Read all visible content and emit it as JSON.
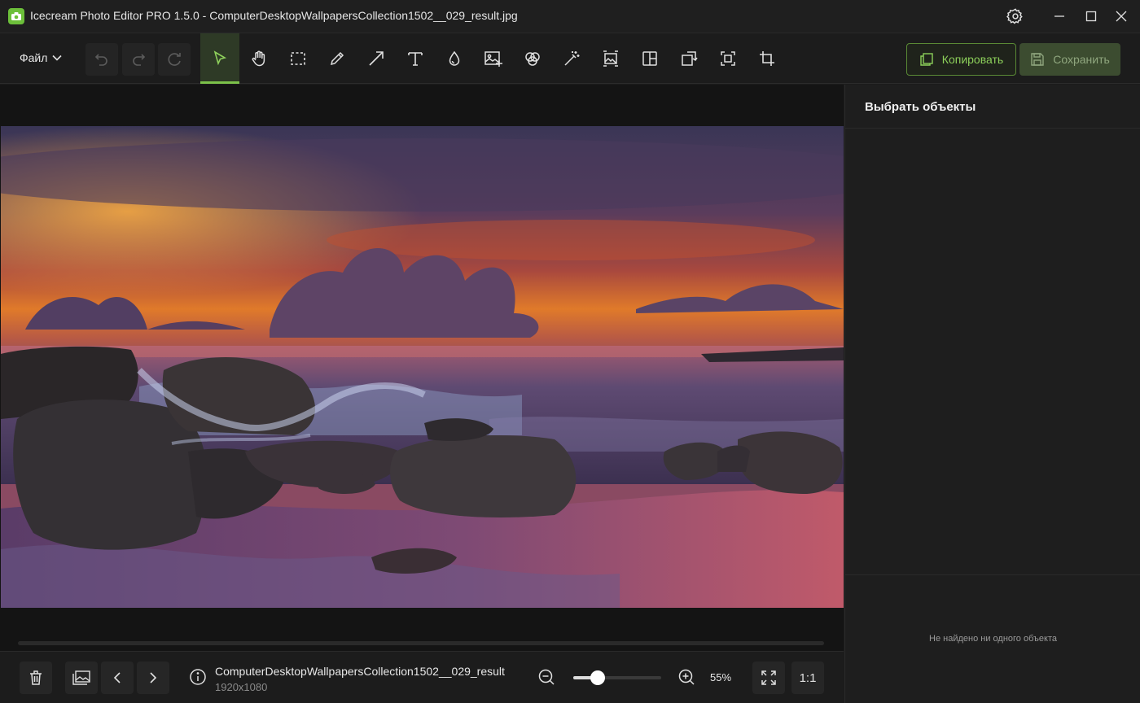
{
  "window": {
    "title": "Icecream Photo Editor PRO 1.5.0 - ComputerDesktopWallpapersCollection1502__029_result.jpg"
  },
  "toolbar": {
    "file_menu": "Файл",
    "copy_label": "Копировать",
    "save_label": "Сохранить",
    "tools": [
      "select-icon",
      "hand-icon",
      "rect-select-icon",
      "pencil-icon",
      "arrow-icon",
      "text-icon",
      "drop-icon",
      "image-add-icon",
      "filters-icon",
      "magic-wand-icon",
      "resize-icon",
      "collage-icon",
      "rotate-icon",
      "frame-icon",
      "crop-icon"
    ],
    "active_tool": "select-icon"
  },
  "panel": {
    "title": "Выбрать объекты",
    "empty_text": "Не найдено ни одного объекта"
  },
  "bottom": {
    "file_name": "ComputerDesktopWallpapersCollection1502__029_result",
    "file_dims": "1920x1080",
    "zoom_percent": "55%",
    "zoom_fraction": 0.27,
    "ratio_label": "1:1"
  },
  "colors": {
    "accent": "#7cc14a",
    "background": "#1c1c1c"
  }
}
